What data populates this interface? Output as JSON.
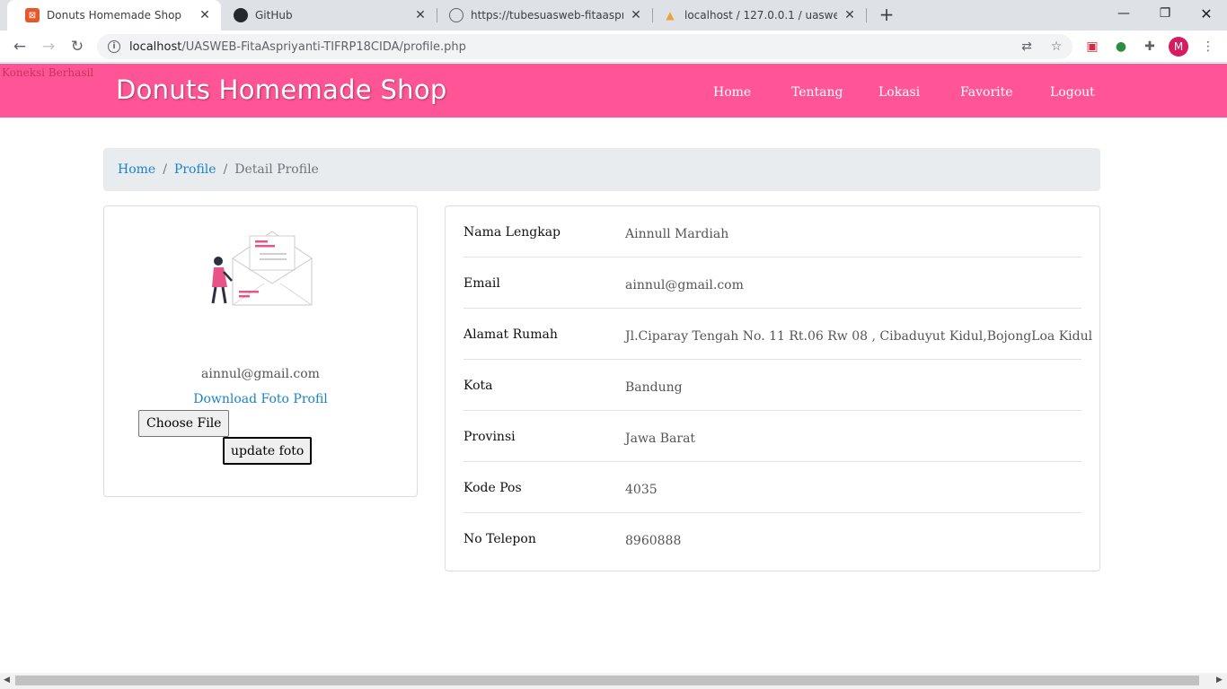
{
  "browser": {
    "tabs": [
      {
        "title": "Donuts Homemade Shop",
        "active": true
      },
      {
        "title": "GitHub",
        "active": false
      },
      {
        "title": "https://tubesuasweb-fitaaspriyan",
        "active": false
      },
      {
        "title": "localhost / 127.0.0.1 / uasweb_fita",
        "active": false
      }
    ],
    "url_host": "localhost",
    "url_path": "/UASWEB-FitaAspriyanti-TIFRP18CIDA/profile.php",
    "profile_initial": "M"
  },
  "page": {
    "status_message": "Koneksi Berhasil",
    "brand": "Donuts Homemade Shop",
    "nav": [
      "Home",
      "Tentang",
      "Lokasi",
      "Favorite",
      "Logout"
    ],
    "breadcrumb": {
      "home": "Home",
      "profile": "Profile",
      "current": "Detail Profile"
    },
    "left_card": {
      "email": "ainnul@gmail.com",
      "download_link": "Download Foto Profil",
      "file_button": "Choose File",
      "update_button": "update foto"
    },
    "details": [
      {
        "label": "Nama Lengkap",
        "value": "Ainnull Mardiah"
      },
      {
        "label": "Email",
        "value": "ainnul@gmail.com"
      },
      {
        "label": "Alamat Rumah",
        "value": "Jl.Ciparay Tengah No. 11 Rt.06 Rw 08 , Cibaduyut Kidul,BojongLoa Kidul"
      },
      {
        "label": "Kota",
        "value": "Bandung"
      },
      {
        "label": "Provinsi",
        "value": "Jawa Barat"
      },
      {
        "label": "Kode Pos",
        "value": "4035"
      },
      {
        "label": "No Telepon",
        "value": "8960888"
      }
    ]
  },
  "colors": {
    "brand_pink": "#ff5596",
    "link_blue": "#1a83c6",
    "breadcrumb_bg": "#e9ecef"
  }
}
